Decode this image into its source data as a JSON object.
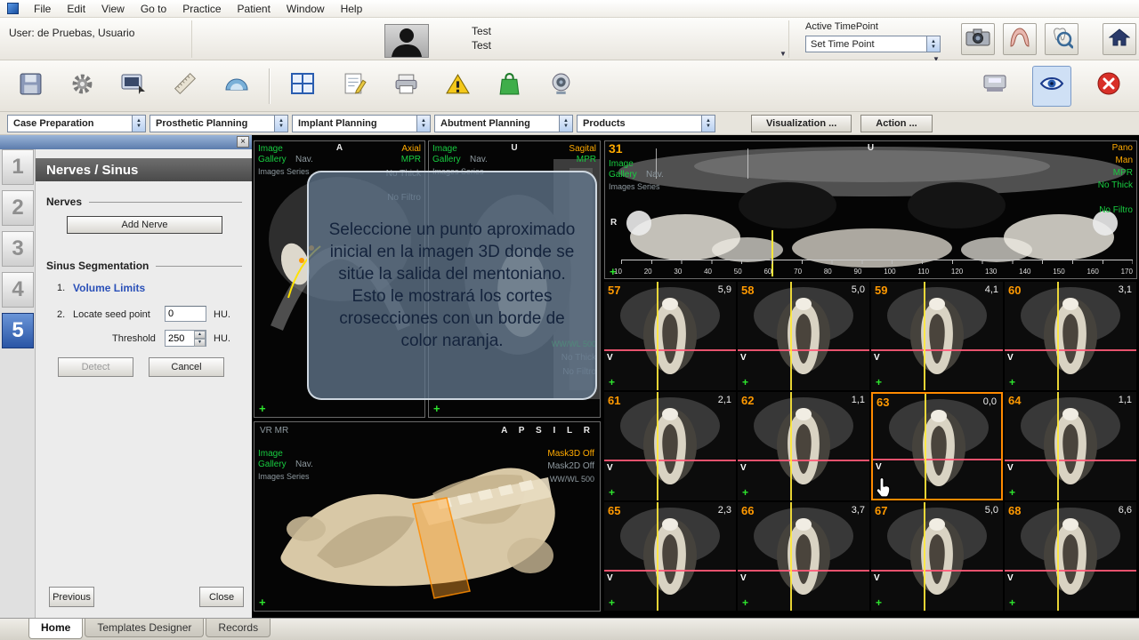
{
  "menubar": {
    "items": [
      "File",
      "Edit",
      "View",
      "Go to",
      "Practice",
      "Patient",
      "Window",
      "Help"
    ]
  },
  "userbar": {
    "user_label": "User: de Pruebas, Usuario",
    "patient_first": "Test",
    "patient_last": "Test",
    "timepoint_label": "Active TimePoint",
    "timepoint_value": "Set Time Point"
  },
  "toolbar": {
    "left_icons": [
      "save-icon",
      "settings-gear-icon",
      "screen-capture-icon",
      "ruler-icon",
      "protractor-icon",
      "layout-grid-icon",
      "notes-icon",
      "print-icon",
      "warning-icon",
      "shop-bag-icon",
      "camera-scope-icon"
    ],
    "right_icons": [
      "card-printer-icon",
      "visibility-eye-icon",
      "close-red-icon"
    ],
    "top_right_icons": [
      "photo-camera-icon",
      "dental-arch-icon",
      "tooth-magnifier-icon",
      "home-icon"
    ]
  },
  "workflow": {
    "dropdowns": [
      "Case Preparation",
      "Prosthetic Planning",
      "Implant Planning",
      "Abutment Planning",
      "Products"
    ],
    "buttons": [
      "Visualization ...",
      "Action ..."
    ]
  },
  "panel": {
    "title": "Nerves / Sinus",
    "close_x": "×",
    "steps": [
      "1",
      "2",
      "3",
      "4",
      "5"
    ],
    "active_step_index": 4,
    "nerves_section": "Nerves",
    "add_nerve": "Add Nerve",
    "sinus_section": "Sinus Segmentation",
    "step1_num": "1.",
    "step1_label": "Volume Limits",
    "step2_num": "2.",
    "step2_label": "Locate seed point",
    "seed_value": "0",
    "seed_unit": "HU.",
    "threshold_label": "Threshold",
    "threshold_value": "250",
    "threshold_unit": "HU.",
    "detect": "Detect",
    "cancel": "Cancel",
    "previous": "Previous",
    "close": "Close"
  },
  "viewers": {
    "axial": {
      "gallery": [
        "Image",
        "Gallery",
        "Nav.",
        "Images Series"
      ],
      "top": "A",
      "type": "Axial",
      "mode": "MPR",
      "right": [
        "No Thick",
        "No Filtro"
      ],
      "plus": "+"
    },
    "sagital": {
      "gallery": [
        "Image",
        "Gallery",
        "Nav.",
        "Images Series"
      ],
      "top": "U",
      "type": "Sagital",
      "mode": "MPR",
      "right": [
        "WW/WL 500",
        "No Thick",
        "No Filtro"
      ],
      "plus": "+"
    },
    "pano": {
      "number": "31",
      "gallery": [
        "Image",
        "Gallery",
        "Nav.",
        "Images Series"
      ],
      "top": "U",
      "left": "R",
      "right": [
        "Pano",
        "Man",
        "MPR",
        "No Thick",
        "No Filtro"
      ],
      "plus": "+",
      "ruler": [
        "10",
        "20",
        "30",
        "40",
        "50",
        "60",
        "70",
        "80",
        "90",
        "100",
        "110",
        "120",
        "130",
        "140",
        "150",
        "160",
        "170"
      ]
    },
    "volume": {
      "top_left": "VR  MR",
      "top_right": "A  P  S  I  L  R",
      "gallery": [
        "Image",
        "Gallery",
        "Nav.",
        "Images Series"
      ],
      "right": [
        "Mask3D Off",
        "Mask2D Off",
        "WW/WL 500"
      ],
      "plus": "+"
    }
  },
  "tooltip": {
    "text": "Seleccione un punto aproximado inicial en la imagen 3D donde se sitúe la salida del mentoniano. Esto le mostrará los cortes crosecciones con un borde de color naranja."
  },
  "slices": {
    "v_label": "V",
    "plus": "+",
    "items": [
      {
        "num": "57",
        "val": "5,9"
      },
      {
        "num": "58",
        "val": "5,0"
      },
      {
        "num": "59",
        "val": "4,1"
      },
      {
        "num": "60",
        "val": "3,1"
      },
      {
        "num": "61",
        "val": "2,1"
      },
      {
        "num": "62",
        "val": "1,1"
      },
      {
        "num": "63",
        "val": "0,0",
        "selected": true
      },
      {
        "num": "64",
        "val": "1,1"
      },
      {
        "num": "65",
        "val": "2,3"
      },
      {
        "num": "66",
        "val": "3,7"
      },
      {
        "num": "67",
        "val": "5,0"
      },
      {
        "num": "68",
        "val": "6,6"
      }
    ]
  },
  "tabs": {
    "items": [
      "Home",
      "Templates Designer",
      "Records"
    ],
    "active_index": 0
  },
  "colors": {
    "accent_blue": "#2a55a5",
    "selection_orange": "#ff8a00",
    "label_green": "#18cc40",
    "label_orange": "#ffaa00",
    "crosshair_red": "#ff5a78",
    "crosshair_yellow": "#ffe93a"
  }
}
